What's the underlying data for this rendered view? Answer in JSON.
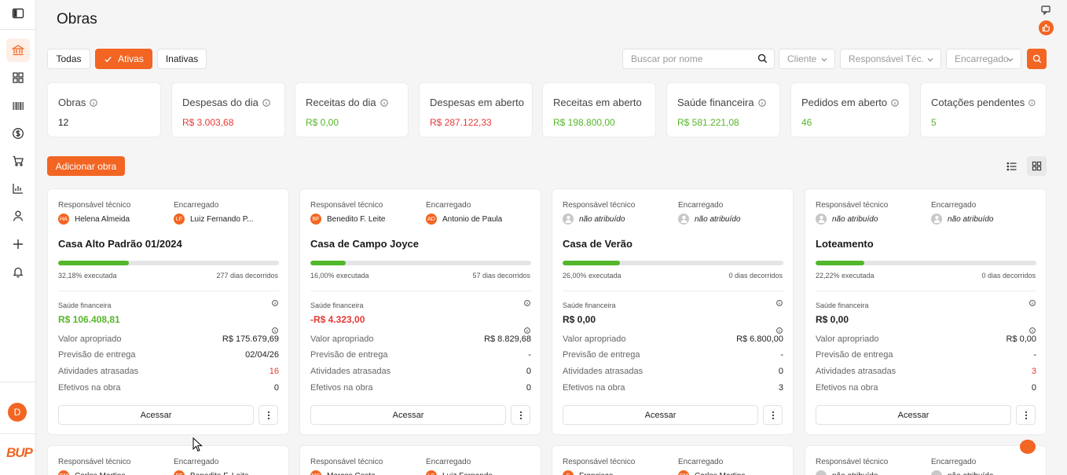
{
  "page": {
    "title": "Obras"
  },
  "colors": {
    "accent": "#f26522",
    "positive": "#57b52a",
    "negative": "#e53935"
  },
  "sidebar": {
    "icons": [
      "sidebar-toggle-icon",
      "bank-icon",
      "grid-icon",
      "barcode-icon",
      "dollar-icon",
      "cart-icon",
      "chart-icon",
      "user-icon",
      "plus-icon",
      "bell-icon"
    ],
    "user_initial": "D",
    "logo": "BUP"
  },
  "filters": {
    "tabs": [
      {
        "label": "Todas",
        "active": false
      },
      {
        "label": "Ativas",
        "active": true
      },
      {
        "label": "Inativas",
        "active": false
      }
    ],
    "search_placeholder": "Buscar por nome",
    "selects": [
      "Cliente",
      "Responsável Téc.",
      "Encarregado"
    ]
  },
  "kpis": [
    {
      "label": "Obras",
      "value": "12",
      "tone": "dark",
      "info": true
    },
    {
      "label": "Despesas do dia",
      "value": "R$ 3.003,68",
      "tone": "red",
      "info": true
    },
    {
      "label": "Receitas do dia",
      "value": "R$ 0,00",
      "tone": "green",
      "info": true
    },
    {
      "label": "Despesas em aberto",
      "value": "R$ 287.122,33",
      "tone": "red",
      "info": false
    },
    {
      "label": "Receitas em aberto",
      "value": "R$ 198.800,00",
      "tone": "green",
      "info": false
    },
    {
      "label": "Saúde financeira",
      "value": "R$ 581.221,08",
      "tone": "green",
      "info": true
    },
    {
      "label": "Pedidos em aberto",
      "value": "46",
      "tone": "green",
      "info": true
    },
    {
      "label": "Cotações pendentes",
      "value": "5",
      "tone": "green",
      "info": true
    }
  ],
  "actions": {
    "add_label": "Adicionar obra"
  },
  "labels": {
    "resp": "Responsável técnico",
    "enc": "Encarregado",
    "saude": "Saúde financeira",
    "valor": "Valor apropriado",
    "previsao": "Previsão de entrega",
    "atividades": "Atividades atrasadas",
    "efetivos": "Efetivos na obra",
    "acessar": "Acessar"
  },
  "obras": [
    {
      "resp": {
        "initials": "HA",
        "name": "Helena Almeida",
        "assigned": true
      },
      "enc": {
        "initials": "LF",
        "name": "Luiz Fernando P...",
        "assigned": true
      },
      "title": "Casa Alto Padrão 01/2024",
      "progress": 0.3218,
      "executed": "32,18% executada",
      "days": "277 dias decorridos",
      "saude": "R$ 106.408,81",
      "saude_tone": "green",
      "valor": "R$ 175.679,69",
      "previsao": "02/04/26",
      "atividades": "16",
      "atividades_alert": true,
      "efetivos": "0"
    },
    {
      "resp": {
        "initials": "BF",
        "name": "Benedito F. Leite",
        "assigned": true
      },
      "enc": {
        "initials": "AD",
        "name": "Antonio de Paula",
        "assigned": true
      },
      "title": "Casa de Campo Joyce",
      "progress": 0.16,
      "executed": "16,00% executada",
      "days": "57 dias decorridos",
      "saude": "-R$ 4.323,00",
      "saude_tone": "red",
      "valor": "R$ 8.829,68",
      "previsao": "-",
      "atividades": "0",
      "atividades_alert": false,
      "efetivos": "0"
    },
    {
      "resp": {
        "initials": "",
        "name": "não atribuído",
        "assigned": false
      },
      "enc": {
        "initials": "",
        "name": "não atribuído",
        "assigned": false
      },
      "title": "Casa de Verão",
      "progress": 0.26,
      "executed": "26,00% executada",
      "days": "0 dias decorridos",
      "saude": "R$ 0,00",
      "saude_tone": "dark",
      "valor": "R$ 6.800,00",
      "previsao": "-",
      "atividades": "0",
      "atividades_alert": false,
      "efetivos": "3"
    },
    {
      "resp": {
        "initials": "",
        "name": "não atribuído",
        "assigned": false
      },
      "enc": {
        "initials": "",
        "name": "não atribuído",
        "assigned": false
      },
      "title": "Loteamento",
      "progress": 0.2222,
      "executed": "22,22% executada",
      "days": "0 dias decorridos",
      "saude": "R$ 0,00",
      "saude_tone": "dark",
      "valor": "R$ 0,00",
      "previsao": "-",
      "atividades": "3",
      "atividades_alert": true,
      "efetivos": "0"
    }
  ],
  "obras_row2": [
    {
      "resp": "Carlos Martins",
      "resp_initials": "CM",
      "enc": "Benedito F. Leite",
      "enc_initials": "BF"
    },
    {
      "resp": "Marcos Costa",
      "resp_initials": "MC",
      "enc": "Luiz Fernando",
      "enc_initials": "LF"
    },
    {
      "resp": "Francisco",
      "resp_initials": "F",
      "enc": "Carlos Martins",
      "enc_initials": "CM"
    },
    {
      "resp": "não atribuído",
      "resp_initials": "",
      "enc": "não atribuído",
      "enc_initials": ""
    }
  ]
}
